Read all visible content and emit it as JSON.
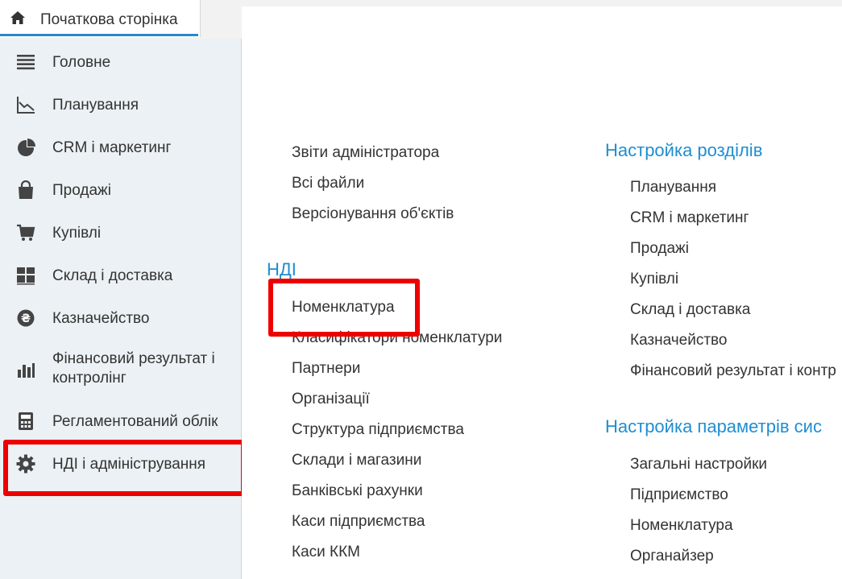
{
  "home_tab": {
    "label": "Початкова сторінка",
    "icon": "home-icon"
  },
  "sidebar": {
    "items": [
      {
        "id": "main",
        "label": "Головне",
        "icon": "list-icon"
      },
      {
        "id": "planning",
        "label": "Планування",
        "icon": "chart-line-icon"
      },
      {
        "id": "crm",
        "label": "CRM і маркетинг",
        "icon": "pie-chart-icon"
      },
      {
        "id": "sales",
        "label": "Продажі",
        "icon": "bag-icon"
      },
      {
        "id": "purchases",
        "label": "Купівлі",
        "icon": "cart-icon"
      },
      {
        "id": "warehouse",
        "label": "Склад і доставка",
        "icon": "grid-icon"
      },
      {
        "id": "treasury",
        "label": "Казначейство",
        "icon": "coin-icon"
      },
      {
        "id": "finance",
        "label": "Фінансовий результат і",
        "label2": "контролінг",
        "icon": "bar-chart-icon"
      },
      {
        "id": "regulated",
        "label": "Регламентований облік",
        "icon": "calculator-icon"
      },
      {
        "id": "admin",
        "label": "НДІ і адміністрування",
        "icon": "gear-icon"
      }
    ]
  },
  "left_column": {
    "top_links": [
      "Звіти адміністратора",
      "Всі файли",
      "Версіонування об'єктів"
    ],
    "ndi_title": "НДІ",
    "ndi_links": [
      "Номенклатура",
      "Класифікатори номенклатури",
      "Партнери",
      "Організації",
      "Структура підприємства",
      "Склади і магазини",
      "Банківські рахунки",
      "Каси підприємства",
      "Каси ККМ"
    ]
  },
  "right_column": {
    "sections_title": "Настройка розділів",
    "sections_links": [
      "Планування",
      "CRM і маркетинг",
      "Продажі",
      "Купівлі",
      "Склад і доставка",
      "Казначейство",
      "Фінансовий результат і контр"
    ],
    "params_title": "Настройка параметрів сис",
    "params_links": [
      "Загальні настройки",
      "Підприємство",
      "Номенклатура",
      "Органайзер"
    ]
  },
  "colors": {
    "accent": "#1f8ed0",
    "highlight": "#ee0000",
    "sidebar_bg": "#ebf1f4"
  }
}
